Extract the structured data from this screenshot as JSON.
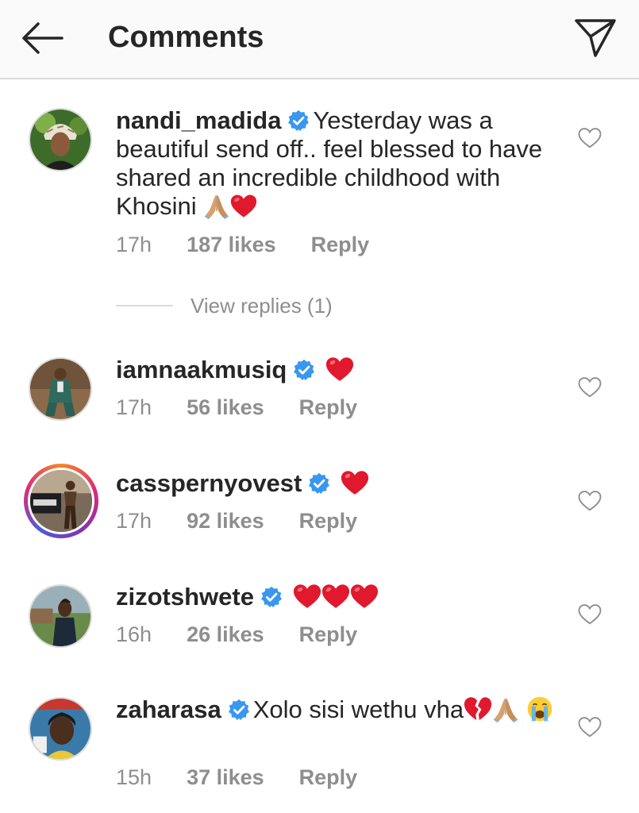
{
  "header": {
    "title": "Comments",
    "back_icon": "arrow-left-icon",
    "send_icon": "paper-plane-icon"
  },
  "colors": {
    "verified_blue": "#3897f0",
    "muted_text": "#8e8e8e",
    "heart_red": "#e0192e"
  },
  "comments": [
    {
      "username": "nandi_madida",
      "verified": true,
      "text": "Yesterday was a beautiful send off.. feel blessed to have shared an incredible childhood with Khosini",
      "emojis": [
        "folded-hands",
        "red-heart"
      ],
      "time": "17h",
      "likes": "187 likes",
      "reply": "Reply",
      "view_replies": "View replies (1)"
    },
    {
      "username": "iamnaakmusiq",
      "verified": true,
      "text": "",
      "emojis": [
        "red-heart"
      ],
      "time": "17h",
      "likes": "56 likes",
      "reply": "Reply"
    },
    {
      "username": "casspernyovest",
      "verified": true,
      "text": "",
      "emojis": [
        "red-heart"
      ],
      "time": "17h",
      "likes": "92 likes",
      "reply": "Reply",
      "has_story": true
    },
    {
      "username": "zizotshwete",
      "verified": true,
      "text": "",
      "emojis": [
        "red-heart",
        "red-heart",
        "red-heart"
      ],
      "time": "16h",
      "likes": "26 likes",
      "reply": "Reply"
    },
    {
      "username": "zaharasa",
      "verified": true,
      "text": "Xolo sisi wethu vha",
      "emojis": [
        "broken-heart",
        "folded-hands",
        "loudly-crying-face"
      ],
      "time": "15h",
      "likes": "37 likes",
      "reply": "Reply"
    }
  ]
}
